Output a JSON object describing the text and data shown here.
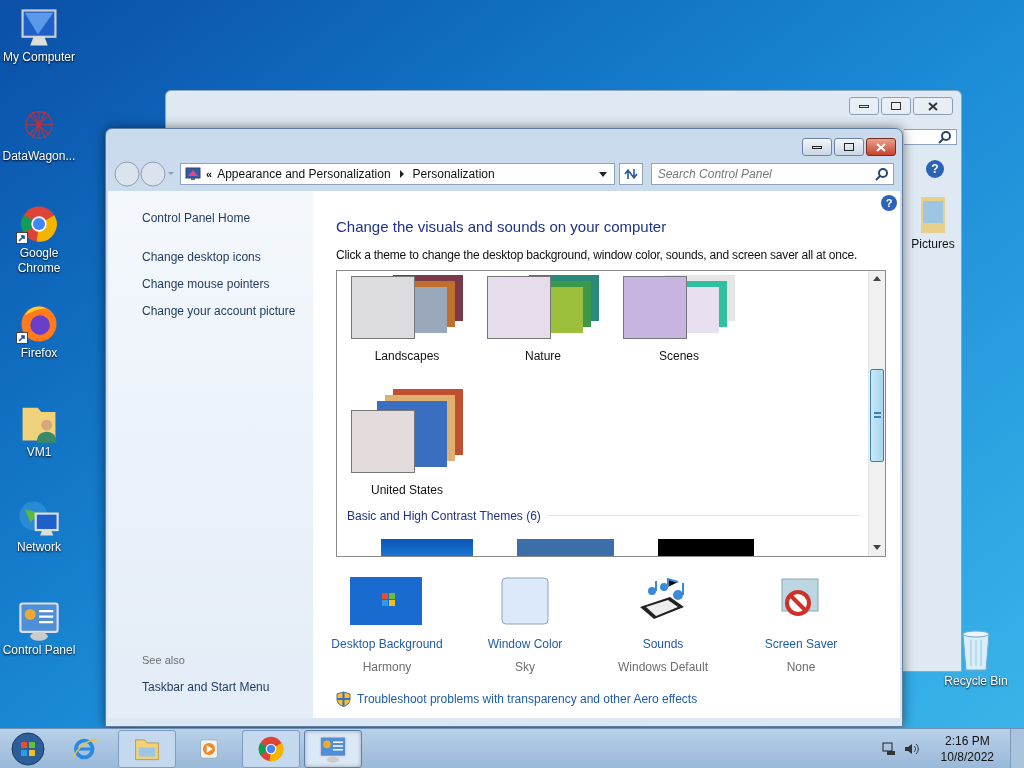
{
  "desktop_icons": [
    {
      "label": "My Computer",
      "kind": "computer"
    },
    {
      "label": "DataWagon...",
      "kind": "web"
    },
    {
      "label": "Google Chrome",
      "kind": "chrome",
      "shortcut": true
    },
    {
      "label": "Firefox",
      "kind": "firefox",
      "shortcut": true
    },
    {
      "label": "VM1",
      "kind": "userfolder"
    },
    {
      "label": "Network",
      "kind": "network"
    },
    {
      "label": "Control Panel",
      "kind": "controlpanel"
    }
  ],
  "recycle_bin": {
    "label": "Recycle Bin"
  },
  "back_window": {
    "help": "?",
    "items": [
      {
        "label": "Pictures"
      }
    ]
  },
  "window": {
    "help": "?",
    "overflow_chevron": "«",
    "breadcrumb": [
      "Appearance and Personalization",
      "Personalization"
    ],
    "search": {
      "placeholder": "Search Control Panel"
    },
    "sidebar": {
      "links": [
        "Control Panel Home",
        "Change desktop icons",
        "Change mouse pointers",
        "Change your account picture"
      ],
      "see_also_heading": "See also",
      "see_also": [
        "Taskbar and Start Menu"
      ]
    },
    "heading": "Change the visuals and sounds on your computer",
    "description": "Click a theme to change the desktop background, window color, sounds, and screen saver all at once.",
    "themes": [
      {
        "name": "Landscapes",
        "color": "#dcdce0"
      },
      {
        "name": "Nature",
        "color": "#e6dcea"
      },
      {
        "name": "Scenes",
        "color": "#c8b4e0"
      },
      {
        "name": "United States",
        "color": "#e4dcdc"
      }
    ],
    "section": "Basic and High Contrast Themes (6)",
    "settings": [
      {
        "kind": "background",
        "label": "Desktop Background",
        "value": "Harmony"
      },
      {
        "kind": "color",
        "label": "Window Color",
        "value": "Sky"
      },
      {
        "kind": "sounds",
        "label": "Sounds",
        "value": "Windows Default"
      },
      {
        "kind": "screensaver",
        "label": "Screen Saver",
        "value": "None"
      }
    ],
    "troubleshoot": "Troubleshoot problems with transparency and other Aero effects"
  },
  "taskbar": {
    "apps": [
      {
        "kind": "ie",
        "open": false,
        "selected": false
      },
      {
        "kind": "explorer",
        "open": true,
        "selected": false
      },
      {
        "kind": "media",
        "open": false,
        "selected": false
      },
      {
        "kind": "chrome",
        "open": true,
        "selected": false
      },
      {
        "kind": "controlpanel",
        "open": true,
        "selected": true
      }
    ],
    "time": "2:16 PM",
    "date": "10/8/2022"
  }
}
